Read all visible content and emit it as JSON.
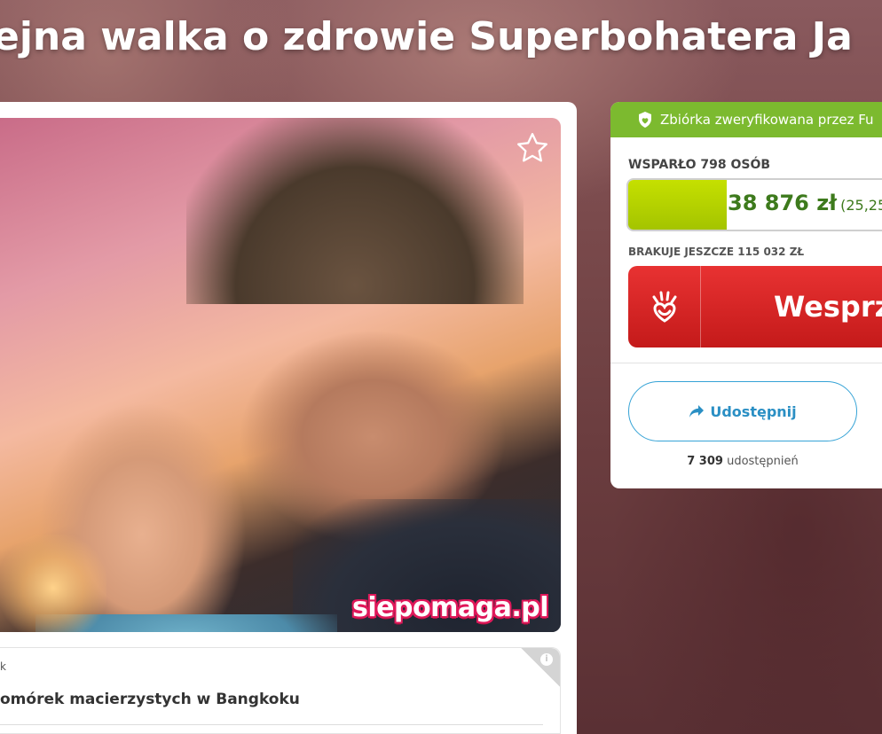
{
  "page": {
    "title": "ejna walka o zdrowie Superbohatera Ja"
  },
  "photo": {
    "watermark": "siepomaga.pl"
  },
  "info": {
    "small": "k",
    "text": "omórek macierzystych w Bangkoku",
    "icon": "i"
  },
  "campaign": {
    "verified_text": "Zbiórka zweryfikowana przez Fu",
    "supported_text": "WSPARŁO 798 OSÓB",
    "amount": "38 876 zł",
    "percent": "(25,25",
    "progress_fraction": 0.2525,
    "missing_text": "BRAKUJE JESZCZE 115 032 ZŁ",
    "support_label": "Wesprz",
    "share_label": "Udostępnij",
    "share_count": "7 309",
    "share_suffix": "udostępnień"
  },
  "colors": {
    "verified_green": "#7cba2f",
    "progress_lime": "#b7d300",
    "amount_green": "#3d7a1c",
    "support_red": "#d42424",
    "share_blue": "#2a8fc4"
  },
  "icons": [
    "star-icon",
    "shield-icon",
    "paw-heart-icon",
    "share-arrow-icon",
    "info-icon"
  ]
}
